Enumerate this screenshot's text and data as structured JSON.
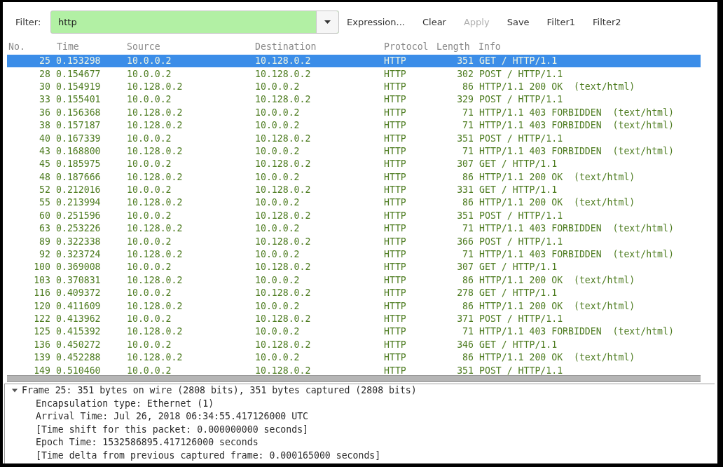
{
  "toolbar": {
    "filter": {
      "label": "Filter:",
      "value": "http",
      "valid": true
    },
    "buttons": [
      {
        "label": "Expression...",
        "disabled": false
      },
      {
        "label": "Clear",
        "disabled": false
      },
      {
        "label": "Apply",
        "disabled": true
      },
      {
        "label": "Save",
        "disabled": false
      },
      {
        "label": "Filter1",
        "disabled": false
      },
      {
        "label": "Filter2",
        "disabled": false
      }
    ]
  },
  "packet_list": {
    "columns": [
      "No.",
      "Time",
      "Source",
      "Destination",
      "Protocol",
      "Length",
      "Info"
    ],
    "rows": [
      {
        "cells": [
          "25",
          "0.153298",
          "10.0.0.2",
          "10.128.0.2",
          "HTTP",
          "351",
          "GET / HTTP/1.1"
        ],
        "selected": true
      },
      {
        "cells": [
          "28",
          "0.154677",
          "10.0.0.2",
          "10.128.0.2",
          "HTTP",
          "302",
          "POST / HTTP/1.1"
        ],
        "selected": false
      },
      {
        "cells": [
          "30",
          "0.154919",
          "10.128.0.2",
          "10.0.0.2",
          "HTTP",
          "86",
          "HTTP/1.1 200 OK  (text/html)"
        ],
        "selected": false
      },
      {
        "cells": [
          "33",
          "0.155401",
          "10.0.0.2",
          "10.128.0.2",
          "HTTP",
          "329",
          "POST / HTTP/1.1"
        ],
        "selected": false
      },
      {
        "cells": [
          "36",
          "0.156368",
          "10.128.0.2",
          "10.0.0.2",
          "HTTP",
          "71",
          "HTTP/1.1 403 FORBIDDEN  (text/html)"
        ],
        "selected": false
      },
      {
        "cells": [
          "38",
          "0.157187",
          "10.128.0.2",
          "10.0.0.2",
          "HTTP",
          "71",
          "HTTP/1.1 403 FORBIDDEN  (text/html)"
        ],
        "selected": false
      },
      {
        "cells": [
          "40",
          "0.167339",
          "10.0.0.2",
          "10.128.0.2",
          "HTTP",
          "351",
          "POST / HTTP/1.1"
        ],
        "selected": false
      },
      {
        "cells": [
          "43",
          "0.168800",
          "10.128.0.2",
          "10.0.0.2",
          "HTTP",
          "71",
          "HTTP/1.1 403 FORBIDDEN  (text/html)"
        ],
        "selected": false
      },
      {
        "cells": [
          "45",
          "0.185975",
          "10.0.0.2",
          "10.128.0.2",
          "HTTP",
          "307",
          "GET / HTTP/1.1"
        ],
        "selected": false
      },
      {
        "cells": [
          "48",
          "0.187666",
          "10.128.0.2",
          "10.0.0.2",
          "HTTP",
          "86",
          "HTTP/1.1 200 OK  (text/html)"
        ],
        "selected": false
      },
      {
        "cells": [
          "52",
          "0.212016",
          "10.0.0.2",
          "10.128.0.2",
          "HTTP",
          "331",
          "GET / HTTP/1.1"
        ],
        "selected": false
      },
      {
        "cells": [
          "55",
          "0.213994",
          "10.128.0.2",
          "10.0.0.2",
          "HTTP",
          "86",
          "HTTP/1.1 200 OK  (text/html)"
        ],
        "selected": false
      },
      {
        "cells": [
          "60",
          "0.251596",
          "10.0.0.2",
          "10.128.0.2",
          "HTTP",
          "351",
          "POST / HTTP/1.1"
        ],
        "selected": false
      },
      {
        "cells": [
          "63",
          "0.253226",
          "10.128.0.2",
          "10.0.0.2",
          "HTTP",
          "71",
          "HTTP/1.1 403 FORBIDDEN  (text/html)"
        ],
        "selected": false
      },
      {
        "cells": [
          "89",
          "0.322338",
          "10.0.0.2",
          "10.128.0.2",
          "HTTP",
          "366",
          "POST / HTTP/1.1"
        ],
        "selected": false
      },
      {
        "cells": [
          "92",
          "0.323724",
          "10.128.0.2",
          "10.0.0.2",
          "HTTP",
          "71",
          "HTTP/1.1 403 FORBIDDEN  (text/html)"
        ],
        "selected": false
      },
      {
        "cells": [
          "100",
          "0.369008",
          "10.0.0.2",
          "10.128.0.2",
          "HTTP",
          "307",
          "GET / HTTP/1.1"
        ],
        "selected": false
      },
      {
        "cells": [
          "103",
          "0.370831",
          "10.128.0.2",
          "10.0.0.2",
          "HTTP",
          "86",
          "HTTP/1.1 200 OK  (text/html)"
        ],
        "selected": false
      },
      {
        "cells": [
          "116",
          "0.409372",
          "10.0.0.2",
          "10.128.0.2",
          "HTTP",
          "278",
          "GET / HTTP/1.1"
        ],
        "selected": false
      },
      {
        "cells": [
          "120",
          "0.411609",
          "10.128.0.2",
          "10.0.0.2",
          "HTTP",
          "86",
          "HTTP/1.1 200 OK  (text/html)"
        ],
        "selected": false
      },
      {
        "cells": [
          "122",
          "0.413962",
          "10.0.0.2",
          "10.128.0.2",
          "HTTP",
          "371",
          "POST / HTTP/1.1"
        ],
        "selected": false
      },
      {
        "cells": [
          "125",
          "0.415392",
          "10.128.0.2",
          "10.0.0.2",
          "HTTP",
          "71",
          "HTTP/1.1 403 FORBIDDEN  (text/html)"
        ],
        "selected": false
      },
      {
        "cells": [
          "136",
          "0.450272",
          "10.0.0.2",
          "10.128.0.2",
          "HTTP",
          "346",
          "GET / HTTP/1.1"
        ],
        "selected": false
      },
      {
        "cells": [
          "139",
          "0.452288",
          "10.128.0.2",
          "10.0.0.2",
          "HTTP",
          "86",
          "HTTP/1.1 200 OK  (text/html)"
        ],
        "selected": false
      },
      {
        "cells": [
          "149",
          "0.510460",
          "10.0.0.2",
          "10.128.0.2",
          "HTTP",
          "351",
          "POST / HTTP/1.1"
        ],
        "selected": false
      }
    ]
  },
  "details": {
    "items": [
      {
        "text": "Frame 25: 351 bytes on wire (2808 bits), 351 bytes captured (2808 bits)",
        "expanded": true,
        "children": [
          {
            "text": "Encapsulation type: Ethernet (1)"
          },
          {
            "text": "Arrival Time: Jul 26, 2018 06:34:55.417126000 UTC"
          },
          {
            "text": "[Time shift for this packet: 0.000000000 seconds]"
          },
          {
            "text": "Epoch Time: 1532586895.417126000 seconds"
          },
          {
            "text": "[Time delta from previous captured frame: 0.000165000 seconds]"
          }
        ]
      }
    ]
  }
}
